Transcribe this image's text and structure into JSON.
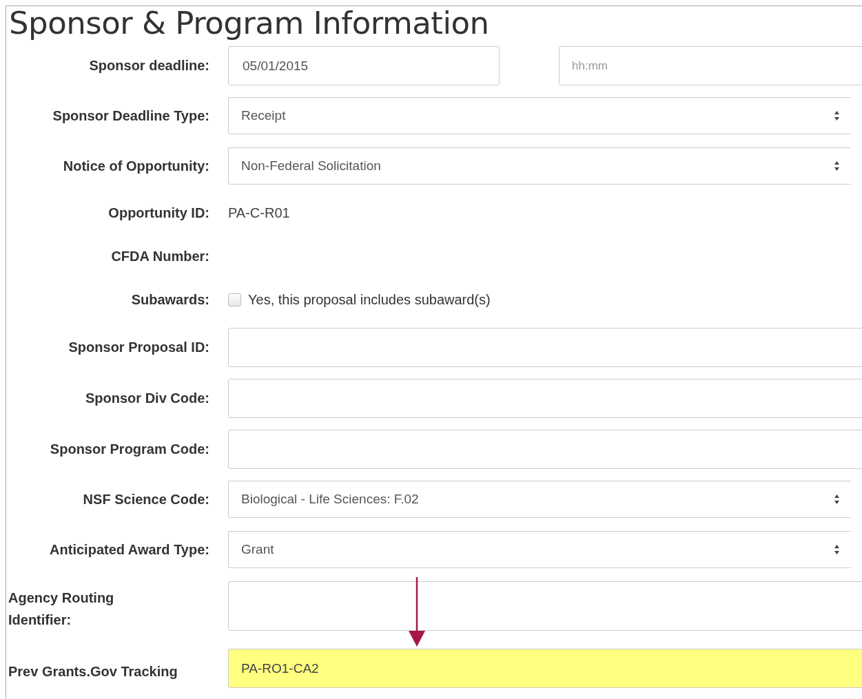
{
  "title": "Sponsor & Program Information",
  "rows": [
    {
      "kind": "date-time",
      "label": "Sponsor deadline:",
      "value": "05/01/2015",
      "time_placeholder": "hh:mm"
    },
    {
      "kind": "select",
      "label": "Sponsor Deadline Type:",
      "value": "Receipt"
    },
    {
      "kind": "select",
      "label": "Notice of Opportunity:",
      "value": "Non-Federal Solicitation"
    },
    {
      "kind": "static",
      "label": "Opportunity ID:",
      "value": "PA-C-R01"
    },
    {
      "kind": "static",
      "label": "CFDA Number:"
    },
    {
      "kind": "checkbox",
      "label": "Subawards:",
      "option": "Yes, this proposal includes subaward(s)",
      "checked": false
    },
    {
      "kind": "text",
      "label": "Sponsor Proposal ID:"
    },
    {
      "kind": "text",
      "label": "Sponsor Div Code:"
    },
    {
      "kind": "text",
      "label": "Sponsor Program Code:"
    },
    {
      "kind": "select",
      "label": "NSF Science Code:",
      "value": "Biological - Life Sciences: F.02"
    },
    {
      "kind": "select",
      "label": "Anticipated Award Type:",
      "value": "Grant"
    },
    {
      "kind": "text",
      "label_lines": [
        "Agency Routing",
        "Identifier:"
      ]
    },
    {
      "kind": "text",
      "label_lines": [
        "Prev Grants.Gov Tracking"
      ],
      "value": "PA-RO1-CA2",
      "highlighted": true
    }
  ]
}
